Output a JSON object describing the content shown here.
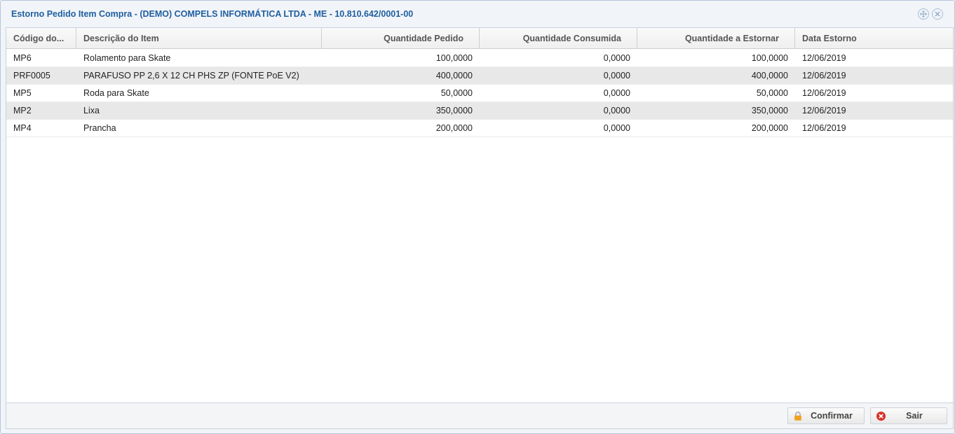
{
  "window": {
    "title": "Estorno Pedido Item Compra - (DEMO) COMPELS INFORMÁTICA LTDA - ME - 10.810.642/0001-00",
    "tools": [
      "move-icon",
      "close-icon"
    ]
  },
  "grid": {
    "columns": [
      "Código do...",
      "Descrição do Item",
      "Quantidade Pedido",
      "Quantidade Consumida",
      "Quantidade a Estornar",
      "Data Estorno"
    ],
    "rows": [
      [
        "MP6",
        "Rolamento para Skate",
        "100,0000",
        "0,0000",
        "100,0000",
        "12/06/2019"
      ],
      [
        "PRF0005",
        "PARAFUSO PP 2,6 X 12 CH PHS ZP (FONTE PoE V2)",
        "400,0000",
        "0,0000",
        "400,0000",
        "12/06/2019"
      ],
      [
        "MP5",
        "Roda para Skate",
        "50,0000",
        "0,0000",
        "50,0000",
        "12/06/2019"
      ],
      [
        "MP2",
        "Lixa",
        "350,0000",
        "0,0000",
        "350,0000",
        "12/06/2019"
      ],
      [
        "MP4",
        "Prancha",
        "200,0000",
        "0,0000",
        "200,0000",
        "12/06/2019"
      ]
    ]
  },
  "footer": {
    "confirm_label": "Confirmar",
    "confirm_icon": "lock-icon",
    "exit_label": "Sair",
    "exit_icon": "cancel-icon"
  },
  "colors": {
    "title": "#1f5fa0",
    "row_alt": "#e8e8e8",
    "lock": "#f0a020",
    "cancel": "#d9342b"
  }
}
